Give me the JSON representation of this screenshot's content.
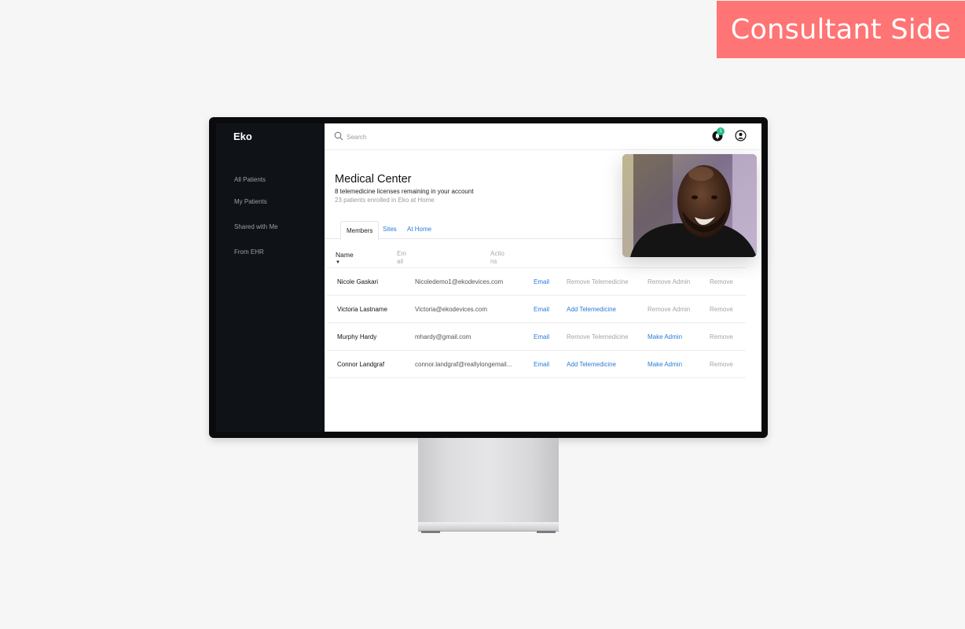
{
  "banner": {
    "label": "Consultant Side"
  },
  "sidebar": {
    "logo": "Eko",
    "items": [
      {
        "label": "All Patients"
      },
      {
        "label": "My Patients"
      },
      {
        "label": "Shared with Me"
      },
      {
        "label": "From EHR"
      }
    ]
  },
  "topbar": {
    "search_placeholder": "Search",
    "notification_count": "1"
  },
  "page": {
    "title": "Medical Center",
    "licenses_text": "8 telemedicine licenses remaining in your account",
    "enrolled_text": "23 patients enrolled in Eko at Home"
  },
  "tabs": [
    {
      "label": "Members"
    },
    {
      "label": "Sites"
    },
    {
      "label": "At Home"
    }
  ],
  "table": {
    "headers": {
      "name": "Name",
      "email": "Email",
      "actions": "Actions"
    },
    "rows": [
      {
        "name": "Nicole Gaskari",
        "email": "Nicoledemo1@ekodevices.com",
        "email_action": "Email",
        "telemedicine_action": "Remove Telemedicine",
        "telemedicine_active": false,
        "admin_action": "Remove Admin",
        "admin_active": false,
        "remove_action": "Remove"
      },
      {
        "name": "Victoria Lastname",
        "email": "Victoria@ekodevices.com",
        "email_action": "Email",
        "telemedicine_action": "Add Telemedicine",
        "telemedicine_active": true,
        "admin_action": "Remove Admin",
        "admin_active": false,
        "remove_action": "Remove"
      },
      {
        "name": "Murphy Hardy",
        "email": "mhardy@gmail.com",
        "email_action": "Email",
        "telemedicine_action": "Remove Telemedicine",
        "telemedicine_active": false,
        "admin_action": "Make Admin",
        "admin_active": true,
        "remove_action": "Remove"
      },
      {
        "name": "Connor Landgraf",
        "email": "connor.landgraf@reallylongemail...",
        "email_action": "Email",
        "telemedicine_action": "Add Telemedicine",
        "telemedicine_active": true,
        "admin_action": "Make Admin",
        "admin_active": true,
        "remove_action": "Remove"
      }
    ]
  },
  "colors": {
    "banner": "#ff7474",
    "sidebar": "#0f1216",
    "link": "#2a7bd8",
    "muted": "#a5a5a5",
    "badge": "#24c18a"
  },
  "icons": [
    "search-icon",
    "notification-bell-icon",
    "user-account-icon"
  ]
}
